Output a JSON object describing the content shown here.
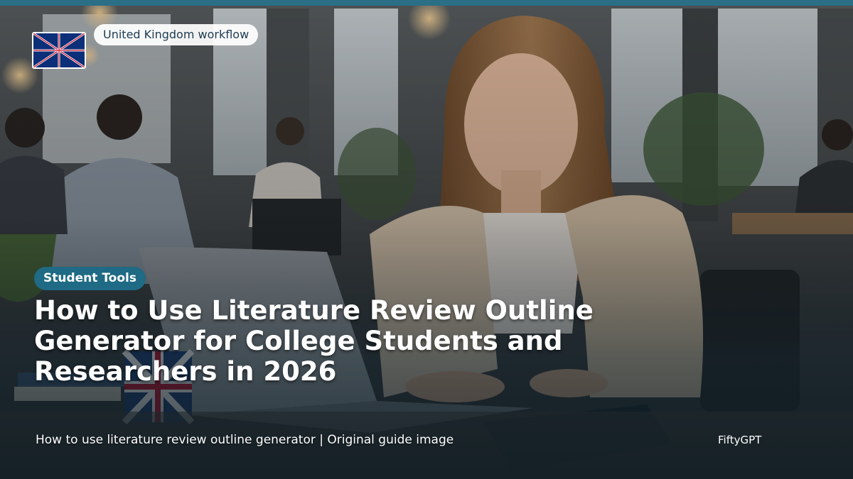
{
  "header": {
    "region_label": "United Kingdom workflow",
    "flag_icon": "uk-flag-icon"
  },
  "main": {
    "category_badge": "Student Tools",
    "title": "How to Use Literature Review Outline Generator for College Students and Researchers in 2026"
  },
  "footer": {
    "caption": "How to use literature review outline generator | Original guide image",
    "brand": "FiftyGPT"
  },
  "colors": {
    "accent": "#2a6f86",
    "badge": "#1f6a84",
    "flag_blue": "#0b2f78",
    "flag_red": "#c8102e"
  }
}
